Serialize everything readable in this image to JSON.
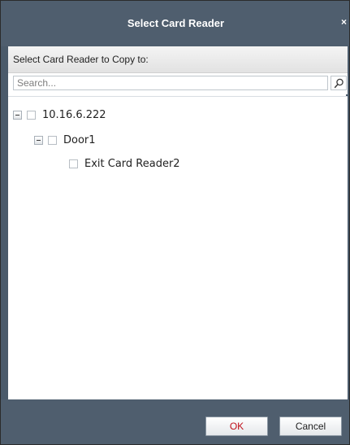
{
  "dialog": {
    "title": "Select Card Reader",
    "close_glyph": "×"
  },
  "section": {
    "heading": "Select Card Reader to Copy to:"
  },
  "search": {
    "placeholder": "Search...",
    "value": "",
    "icon": "search-icon"
  },
  "tree": {
    "nodes": [
      {
        "label": "10.16.6.222",
        "expanded": true,
        "checked": false
      },
      {
        "label": "Door1",
        "expanded": true,
        "checked": false
      },
      {
        "label": "Exit Card Reader2",
        "checked": false
      }
    ]
  },
  "footer": {
    "ok_label": "OK",
    "cancel_label": "Cancel"
  },
  "colors": {
    "titlebar": "#4f5e6e",
    "ok_text": "#c0101a"
  }
}
